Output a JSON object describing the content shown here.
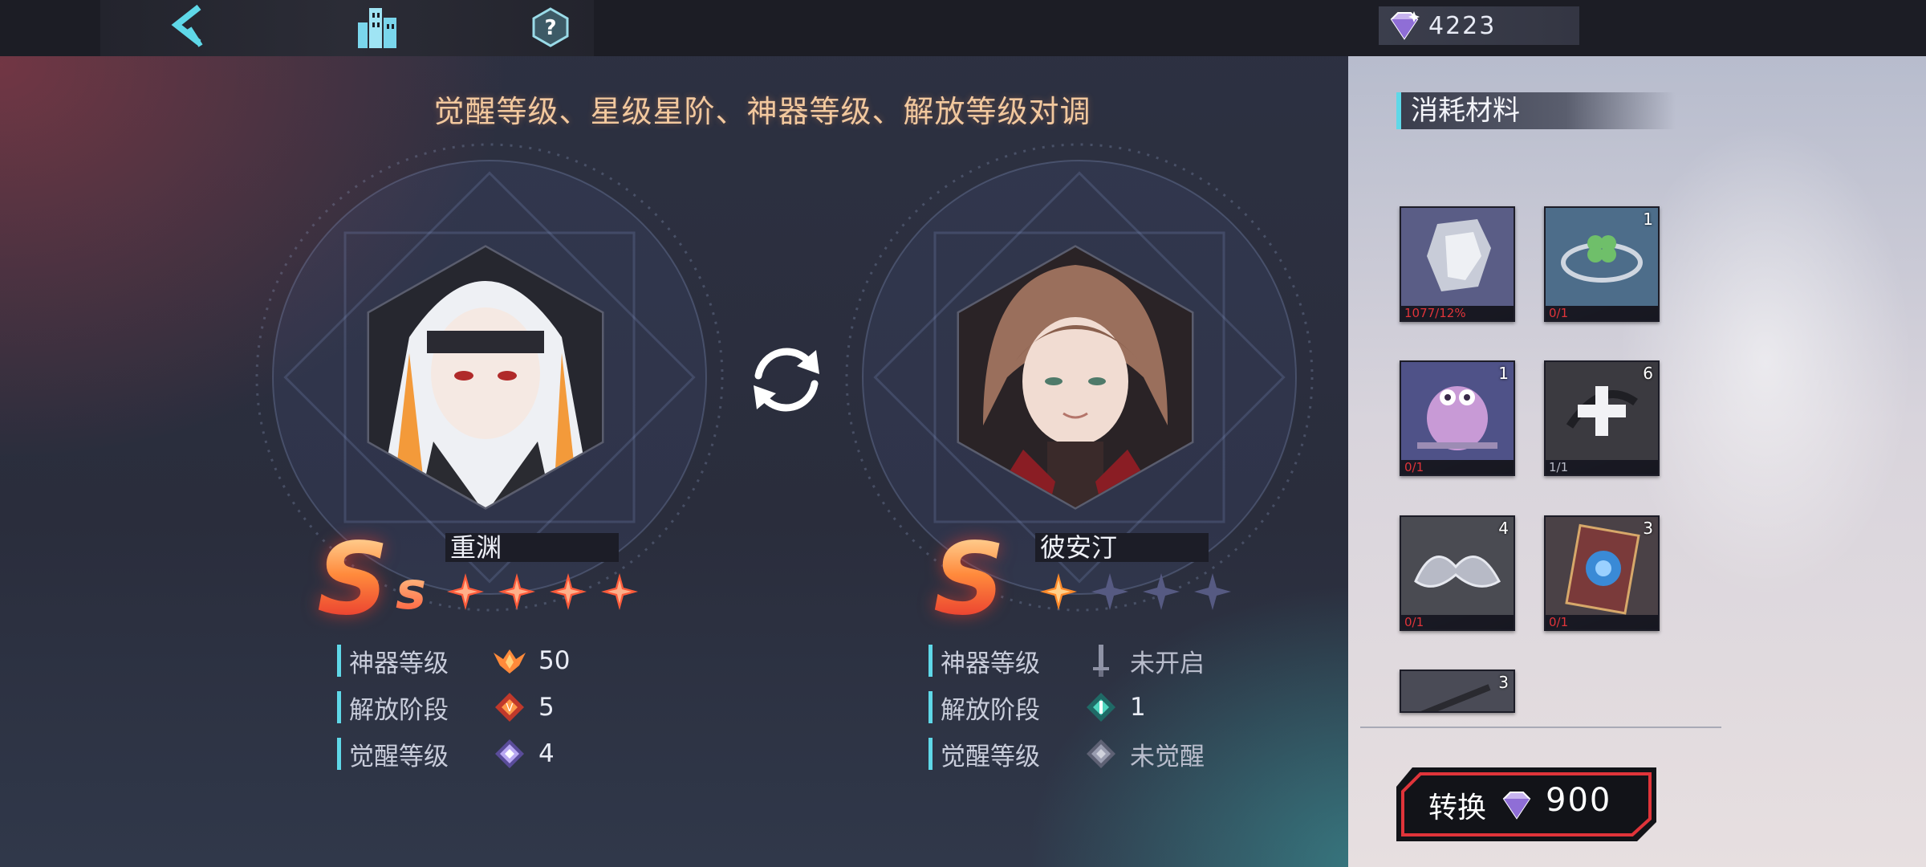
{
  "topbar": {
    "currency_value": "4223"
  },
  "headline": "觉醒等级、星级星阶、神器等级、解放等级对调",
  "left_character": {
    "name": "重渊",
    "rank": "S",
    "rank_suffix": "s",
    "stars_filled": 4,
    "stars_total": 4,
    "stats": [
      {
        "label": "神器等级",
        "value": "50",
        "icon": "artifact-wings-icon"
      },
      {
        "label": "解放阶段",
        "value": "5",
        "icon": "liberation-gem-icon"
      },
      {
        "label": "觉醒等级",
        "value": "4",
        "icon": "awaken-crystal-icon"
      }
    ]
  },
  "right_character": {
    "name": "彼安汀",
    "rank": "S",
    "stars_filled": 1,
    "stars_total": 4,
    "stats": [
      {
        "label": "神器等级",
        "value": "未开启",
        "icon": "artifact-sword-icon"
      },
      {
        "label": "解放阶段",
        "value": "1",
        "icon": "liberation-gem-icon"
      },
      {
        "label": "觉醒等级",
        "value": "未觉醒",
        "icon": "awaken-crystal-icon"
      }
    ]
  },
  "materials": {
    "title": "消耗材料",
    "items": [
      {
        "name": "crystal-shard",
        "count": "",
        "need": "1077/12%",
        "need_color": "red"
      },
      {
        "name": "clover-bracelet",
        "count": "1",
        "need": "0/1",
        "need_color": "red"
      },
      {
        "name": "owl-figure",
        "count": "1",
        "need": "0/1",
        "need_color": "red"
      },
      {
        "name": "plus-box",
        "count": "6",
        "need": "1/1",
        "need_color": "grey"
      },
      {
        "name": "silver-ribbon",
        "count": "4",
        "need": "0/1",
        "need_color": "red"
      },
      {
        "name": "book",
        "count": "3",
        "need": "0/1",
        "need_color": "red"
      },
      {
        "name": "dark-item",
        "count": "3",
        "need": "",
        "need_color": "red"
      }
    ]
  },
  "convert_button": {
    "label": "转换",
    "price": "900"
  },
  "colors": {
    "accent_cyan": "#5fd8e8",
    "headline_orange": "#f2c89e",
    "rank_red": "#e52d2d",
    "need_red": "#e0343a"
  }
}
